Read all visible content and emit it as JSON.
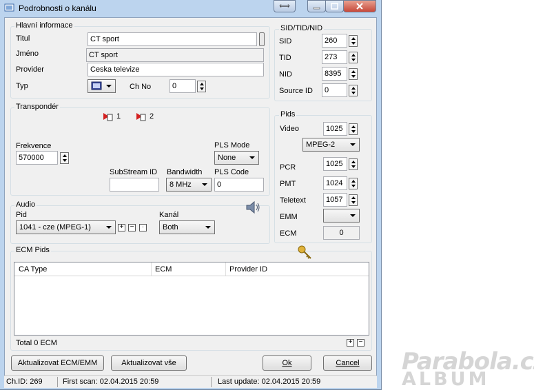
{
  "window": {
    "title": "Podrobnosti o kanálu"
  },
  "main_info": {
    "group_label": "Hlavní informace",
    "titul_label": "Titul",
    "titul_value": "CT sport",
    "jmeno_label": "Jméno",
    "jmeno_value": "CT sport",
    "provider_label": "Provider",
    "provider_value": "Ceska televize",
    "typ_label": "Typ",
    "typ_icon": "tv-icon",
    "chno_label": "Ch No",
    "chno_value": "0"
  },
  "sid": {
    "group_label": "SID/TID/NID",
    "sid_label": "SID",
    "sid_value": "260",
    "tid_label": "TID",
    "tid_value": "273",
    "nid_label": "NID",
    "nid_value": "8395",
    "source_label": "Source ID",
    "source_value": "0"
  },
  "transponder": {
    "group_label": "Transpondér",
    "tp1": "1",
    "tp2": "2",
    "freq_label": "Frekvence",
    "freq_value": "570000",
    "pls_mode_label": "PLS Mode",
    "pls_mode_value": "None",
    "substream_label": "SubStream ID",
    "substream_value": "",
    "bandwidth_label": "Bandwidth",
    "bandwidth_value": "8 MHz",
    "pls_code_label": "PLS Code",
    "pls_code_value": "0"
  },
  "pids": {
    "group_label": "Pids",
    "video_label": "Video",
    "video_value": "1025",
    "video_type": "MPEG-2",
    "pcr_label": "PCR",
    "pcr_value": "1025",
    "pmt_label": "PMT",
    "pmt_value": "1024",
    "teletext_label": "Teletext",
    "teletext_value": "1057",
    "emm_label": "EMM",
    "emm_value": "",
    "ecm_label": "ECM",
    "ecm_value": "0"
  },
  "audio": {
    "group_label": "Audio",
    "pid_label": "Pid",
    "pid_value": "1041 - cze (MPEG-1)",
    "kanal_label": "Kanál",
    "kanal_value": "Both"
  },
  "ecm_pids": {
    "group_label": "ECM Pids",
    "columns": [
      "CA Type",
      "ECM",
      "Provider ID"
    ],
    "total": "Total 0 ECM"
  },
  "buttons": {
    "update_ecm": "Aktualizovat ECM/EMM",
    "update_all": "Aktualizovat vše",
    "ok": "Ok",
    "cancel": "Cancel"
  },
  "status": {
    "chid": "Ch.ID: 269",
    "first_scan": "First scan: 02.04.2015 20:59",
    "last_update": "Last update: 02.04.2015 20:59"
  },
  "watermark": {
    "line1": "Parabola.cz",
    "line2": "ALBUM"
  },
  "colors": {
    "frame": "#bcd4ee",
    "client": "#f0f0f0",
    "close_button": "#c7483a"
  }
}
